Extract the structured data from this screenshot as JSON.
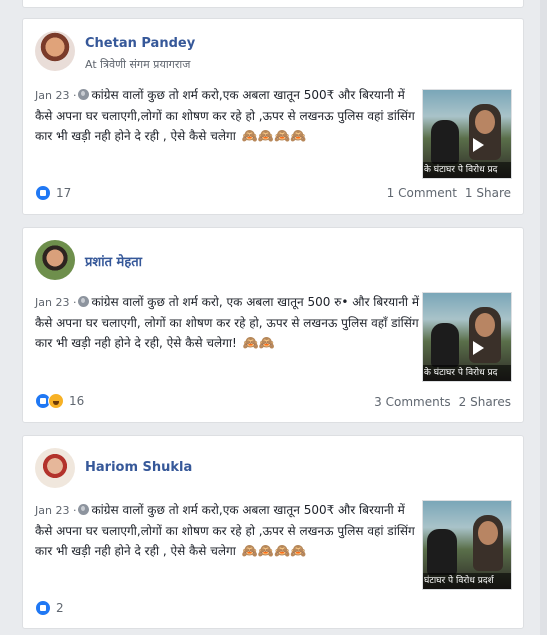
{
  "posts": [
    {
      "author": "Chetan Pandey",
      "location": "At त्रिवेणी संगम प्रयागराज",
      "date": "Jan 23 ·",
      "text": "कांग्रेस वालों कुछ तो शर्म करो,एक अबला खातून 500₹ और बिरयानी में कैसे अपना घर चलाएगी,लोगों का शोषण कर रहे हो ,ऊपर से लखनऊ पुलिस वहां डांसिंग कार भी खड़ी नही होने दे रही , ऐसे कैसे चलेगा",
      "emoji": "🙈🙈🙈🙈",
      "video_caption": "के घंटाघर पे विरोध प्रद",
      "reaction_count": "17",
      "comments": "1 Comment",
      "shares": "1 Share"
    },
    {
      "author": "प्रशांत मेहता",
      "location": "",
      "date": "Jan 23 ·",
      "text": "कांग्रेस वालों कुछ तो शर्म करो, एक अबला खातून 500 रु• और बिरयानी में कैसे अपना घर चलाएगी, लोगों का शोषण कर रहे हो, ऊपर से लखनऊ पुलिस वहाँ डांसिंग कार भी खड़ी नही होने दे रही, ऐसे कैसे चलेगा!",
      "emoji": "🙈🙈",
      "video_caption": "के घंटाघर पे विरोध प्रद",
      "reaction_count": "16",
      "comments": "3 Comments",
      "shares": "2 Shares"
    },
    {
      "author": "Hariom Shukla",
      "location": "",
      "date": "Jan 23 ·",
      "text": "कांग्रेस वालों कुछ तो शर्म करो,एक अबला खातून 500₹ और बिरयानी में कैसे अपना घर चलाएगी,लोगों का शोषण कर रहे हो ,ऊपर से लखनऊ पुलिस वहां डांसिंग कार भी खड़ी नही होने दे रही , ऐसे कैसे चलेगा",
      "emoji": "🙈🙈🙈🙈",
      "video_caption": "घंटाघर पे विरोध प्रदर्श",
      "reaction_count": "2",
      "comments": "",
      "shares": ""
    }
  ],
  "colors": {
    "author": "#365899",
    "like": "#2078f4",
    "background": "#e9ebee"
  },
  "icons": {
    "globe": "globe-icon",
    "play": "play-icon",
    "like": "like-reaction-icon",
    "haha": "haha-reaction-icon",
    "monkey": "see-no-evil-monkey-emoji"
  }
}
